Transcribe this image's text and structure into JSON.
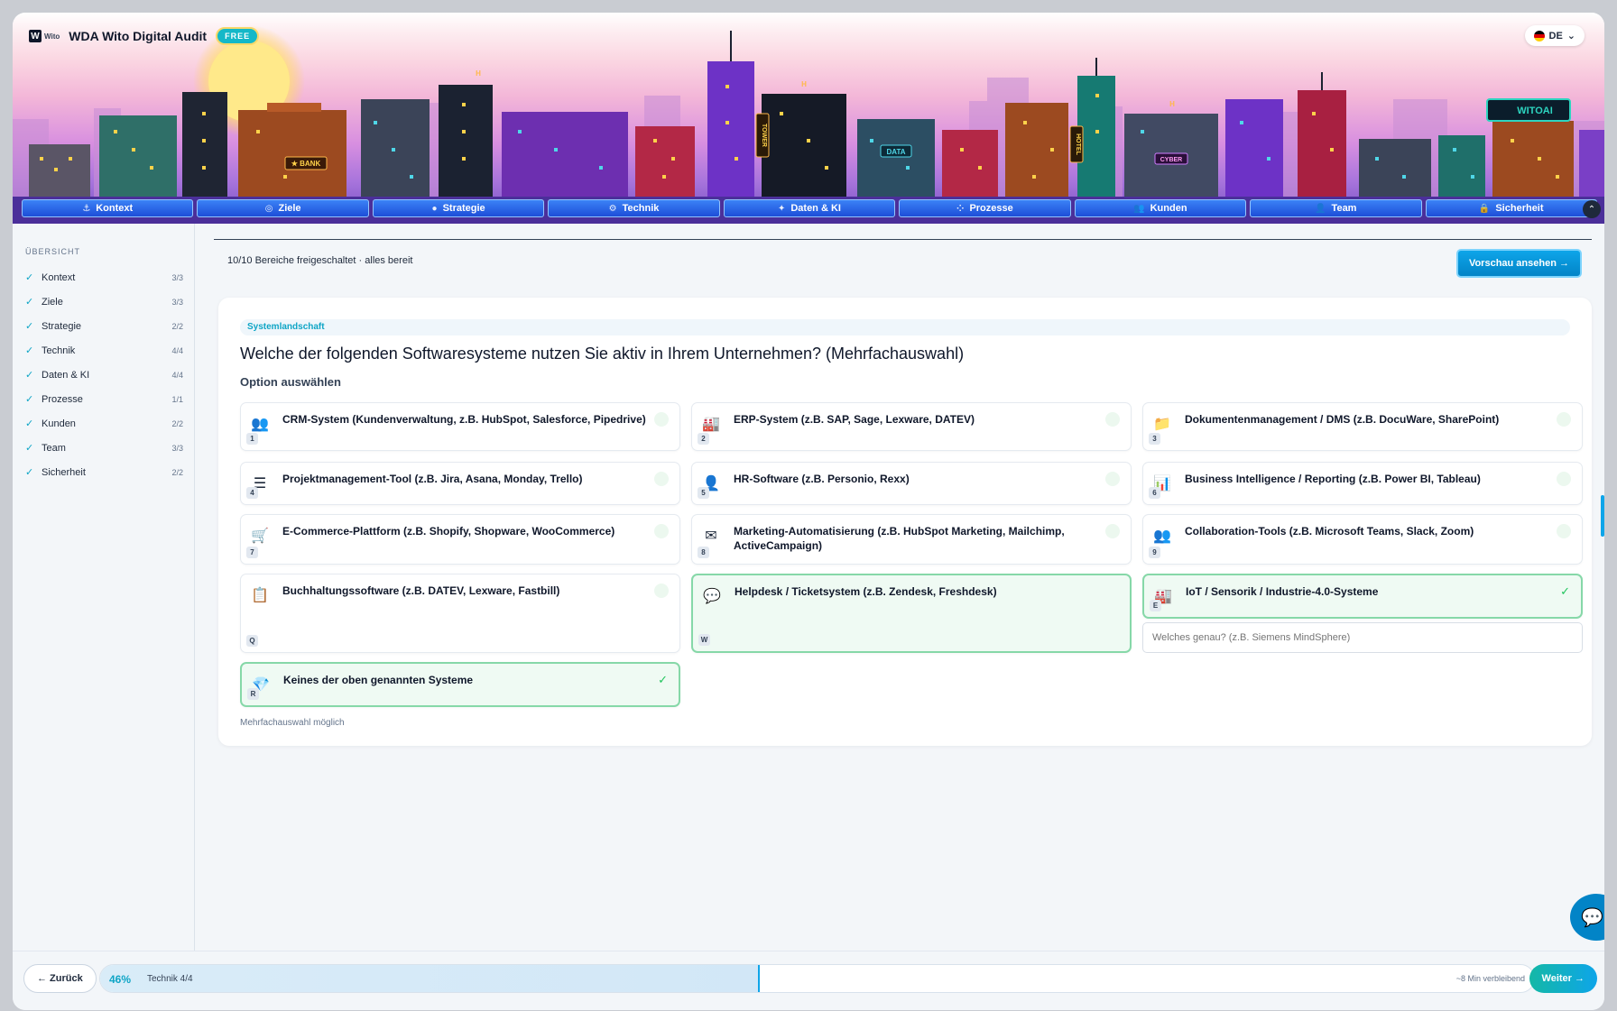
{
  "header": {
    "logo_text": "Wito",
    "title": "WDA Wito Digital Audit",
    "badge": "FREE",
    "language": "DE",
    "signs": {
      "bank": "★ BANK",
      "data": "DATA",
      "cyber": "CYBER",
      "tower": "TOWER",
      "hotel": "HOTEL",
      "witoai": "WITOAI",
      "h": "H"
    }
  },
  "nav": {
    "tabs": [
      {
        "label": "Kontext",
        "icon": "⚓"
      },
      {
        "label": "Ziele",
        "icon": "◎"
      },
      {
        "label": "Strategie",
        "icon": "●"
      },
      {
        "label": "Technik",
        "icon": "⚙"
      },
      {
        "label": "Daten & KI",
        "icon": "✦"
      },
      {
        "label": "Prozesse",
        "icon": "⁘"
      },
      {
        "label": "Kunden",
        "icon": "👥"
      },
      {
        "label": "Team",
        "icon": "👤"
      },
      {
        "label": "Sicherheit",
        "icon": "🔒"
      }
    ]
  },
  "sidebar": {
    "heading": "ÜBERSICHT",
    "items": [
      {
        "label": "Kontext",
        "count": "3/3"
      },
      {
        "label": "Ziele",
        "count": "3/3"
      },
      {
        "label": "Strategie",
        "count": "2/2"
      },
      {
        "label": "Technik",
        "count": "4/4"
      },
      {
        "label": "Daten & KI",
        "count": "4/4"
      },
      {
        "label": "Prozesse",
        "count": "1/1"
      },
      {
        "label": "Kunden",
        "count": "2/2"
      },
      {
        "label": "Team",
        "count": "3/3"
      },
      {
        "label": "Sicherheit",
        "count": "2/2"
      }
    ]
  },
  "main": {
    "status": "10/10 Bereiche freigeschaltet · alles bereit",
    "preview_button": "Vorschau ansehen →",
    "section": "Systemlandschaft",
    "question": "Welche der folgenden Softwaresysteme nutzen Sie aktiv in Ihrem Unternehmen? (Mehrfachauswahl)",
    "subtitle": "Option auswählen",
    "options": [
      {
        "label": "CRM-System (Kundenverwaltung, z.B. HubSpot, Salesforce, Pipedrive)",
        "key": "1",
        "icon": "👥",
        "selected": false
      },
      {
        "label": "ERP-System (z.B. SAP, Sage, Lexware, DATEV)",
        "key": "2",
        "icon": "🏭",
        "selected": false
      },
      {
        "label": "Dokumentenmanagement / DMS (z.B. DocuWare, SharePoint)",
        "key": "3",
        "icon": "📁",
        "selected": false
      },
      {
        "label": "Projektmanagement-Tool (z.B. Jira, Asana, Monday, Trello)",
        "key": "4",
        "icon": "☰",
        "selected": false
      },
      {
        "label": "HR-Software (z.B. Personio, Rexx)",
        "key": "5",
        "icon": "👤",
        "selected": false
      },
      {
        "label": "Business Intelligence / Reporting (z.B. Power BI, Tableau)",
        "key": "6",
        "icon": "📊",
        "selected": false
      },
      {
        "label": "E-Commerce-Plattform (z.B. Shopify, Shopware, WooCommerce)",
        "key": "7",
        "icon": "🛒",
        "selected": false
      },
      {
        "label": "Marketing-Automatisierung (z.B. HubSpot Marketing, Mailchimp, ActiveCampaign)",
        "key": "8",
        "icon": "✉",
        "selected": false
      },
      {
        "label": "Collaboration-Tools (z.B. Microsoft Teams, Slack, Zoom)",
        "key": "9",
        "icon": "👥",
        "selected": false
      },
      {
        "label": "Buchhaltungssoftware (z.B. DATEV, Lexware, Fastbill)",
        "key": "Q",
        "icon": "📋",
        "selected": false
      },
      {
        "label": "Helpdesk / Ticketsystem (z.B. Zendesk, Freshdesk)",
        "key": "W",
        "icon": "💬",
        "selected": true
      },
      {
        "label": "IoT / Sensorik / Industrie-4.0-Systeme",
        "key": "E",
        "icon": "🏭",
        "selected": true
      },
      {
        "label": "Keines der oben genannten Systeme",
        "key": "R",
        "icon": "💎",
        "selected": true
      }
    ],
    "detail_placeholder": "Welches genau? (z.B. Siemens MindSphere)",
    "multi_note": "Mehrfachauswahl möglich"
  },
  "footer": {
    "back_button": "← Zurück",
    "progress_pct": "46%",
    "progress_value": 0.46,
    "step": "Technik 4/4",
    "remaining": "~8 Min verbleibend",
    "next_button": "Weiter →"
  },
  "colors": {
    "accent": "#0ea5c6",
    "nav_blue": "#1d4ed8",
    "selected_border": "#86d8a8",
    "check_green": "#22c55e"
  },
  "icons": {
    "chat": "chat-icon",
    "check": "✓"
  }
}
